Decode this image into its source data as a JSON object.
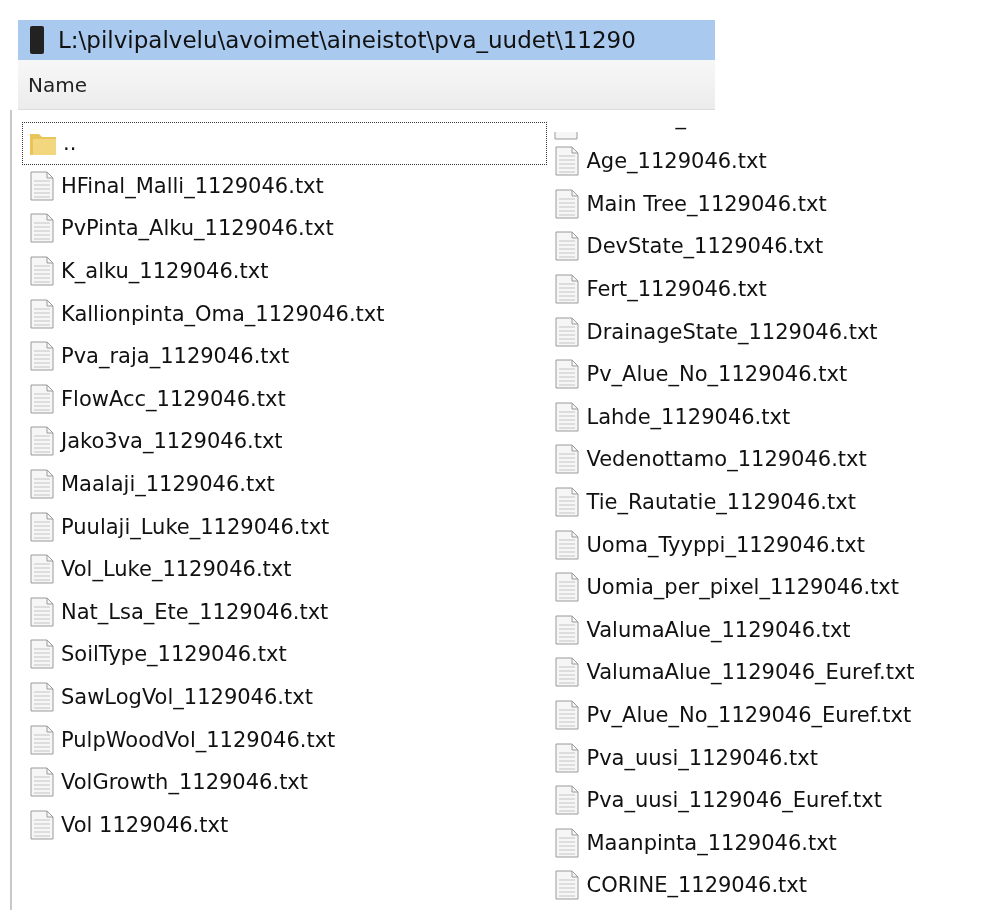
{
  "window": {
    "title": "L:\\pilvipalvelu\\avoimet\\aineistot\\pva_uudet\\11290"
  },
  "header": {
    "column": "Name"
  },
  "columns": [
    {
      "items": [
        {
          "kind": "folder",
          "label": "..",
          "selected": true
        },
        {
          "kind": "file",
          "label": "HFinal_Malli_1129046.txt",
          "selected": false
        },
        {
          "kind": "file",
          "label": "PvPinta_Alku_1129046.txt",
          "selected": false
        },
        {
          "kind": "file",
          "label": "K_alku_1129046.txt",
          "selected": false
        },
        {
          "kind": "file",
          "label": "Kallionpinta_Oma_1129046.txt",
          "selected": false
        },
        {
          "kind": "file",
          "label": "Pva_raja_1129046.txt",
          "selected": false
        },
        {
          "kind": "file",
          "label": "FlowAcc_1129046.txt",
          "selected": false
        },
        {
          "kind": "file",
          "label": "Jako3va_1129046.txt",
          "selected": false
        },
        {
          "kind": "file",
          "label": "Maalaji_1129046.txt",
          "selected": false
        },
        {
          "kind": "file",
          "label": "Puulaji_Luke_1129046.txt",
          "selected": false
        },
        {
          "kind": "file",
          "label": "Vol_Luke_1129046.txt",
          "selected": false
        },
        {
          "kind": "file",
          "label": "Nat_Lsa_Ete_1129046.txt",
          "selected": false
        },
        {
          "kind": "file",
          "label": "SoilType_1129046.txt",
          "selected": false
        },
        {
          "kind": "file",
          "label": "SawLogVol_1129046.txt",
          "selected": false
        },
        {
          "kind": "file",
          "label": "PulpWoodVol_1129046.txt",
          "selected": false
        },
        {
          "kind": "file",
          "label": "VolGrowth_1129046.txt",
          "selected": false
        },
        {
          "kind": "file",
          "label": "Vol 1129046.txt",
          "selected": false
        }
      ]
    },
    {
      "items": [
        {
          "kind": "partial",
          "label": "_",
          "selected": false
        },
        {
          "kind": "file",
          "label": "Age_1129046.txt",
          "selected": false
        },
        {
          "kind": "file",
          "label": "Main Tree_1129046.txt",
          "selected": false
        },
        {
          "kind": "file",
          "label": "DevState_1129046.txt",
          "selected": false
        },
        {
          "kind": "file",
          "label": "Fert_1129046.txt",
          "selected": false
        },
        {
          "kind": "file",
          "label": "DrainageState_1129046.txt",
          "selected": false
        },
        {
          "kind": "file",
          "label": "Pv_Alue_No_1129046.txt",
          "selected": false
        },
        {
          "kind": "file",
          "label": "Lahde_1129046.txt",
          "selected": false
        },
        {
          "kind": "file",
          "label": "Vedenottamo_1129046.txt",
          "selected": false
        },
        {
          "kind": "file",
          "label": "Tie_Rautatie_1129046.txt",
          "selected": false
        },
        {
          "kind": "file",
          "label": "Uoma_Tyyppi_1129046.txt",
          "selected": false
        },
        {
          "kind": "file",
          "label": "Uomia_per_pixel_1129046.txt",
          "selected": false
        },
        {
          "kind": "file",
          "label": "ValumaAlue_1129046.txt",
          "selected": false
        },
        {
          "kind": "file",
          "label": "ValumaAlue_1129046_Euref.txt",
          "selected": false
        },
        {
          "kind": "file",
          "label": "Pv_Alue_No_1129046_Euref.txt",
          "selected": false
        },
        {
          "kind": "file",
          "label": "Pva_uusi_1129046.txt",
          "selected": false
        },
        {
          "kind": "file",
          "label": "Pva_uusi_1129046_Euref.txt",
          "selected": false
        },
        {
          "kind": "file",
          "label": "Maanpinta_1129046.txt",
          "selected": false
        },
        {
          "kind": "file",
          "label": "CORINE_1129046.txt",
          "selected": false
        }
      ]
    }
  ]
}
